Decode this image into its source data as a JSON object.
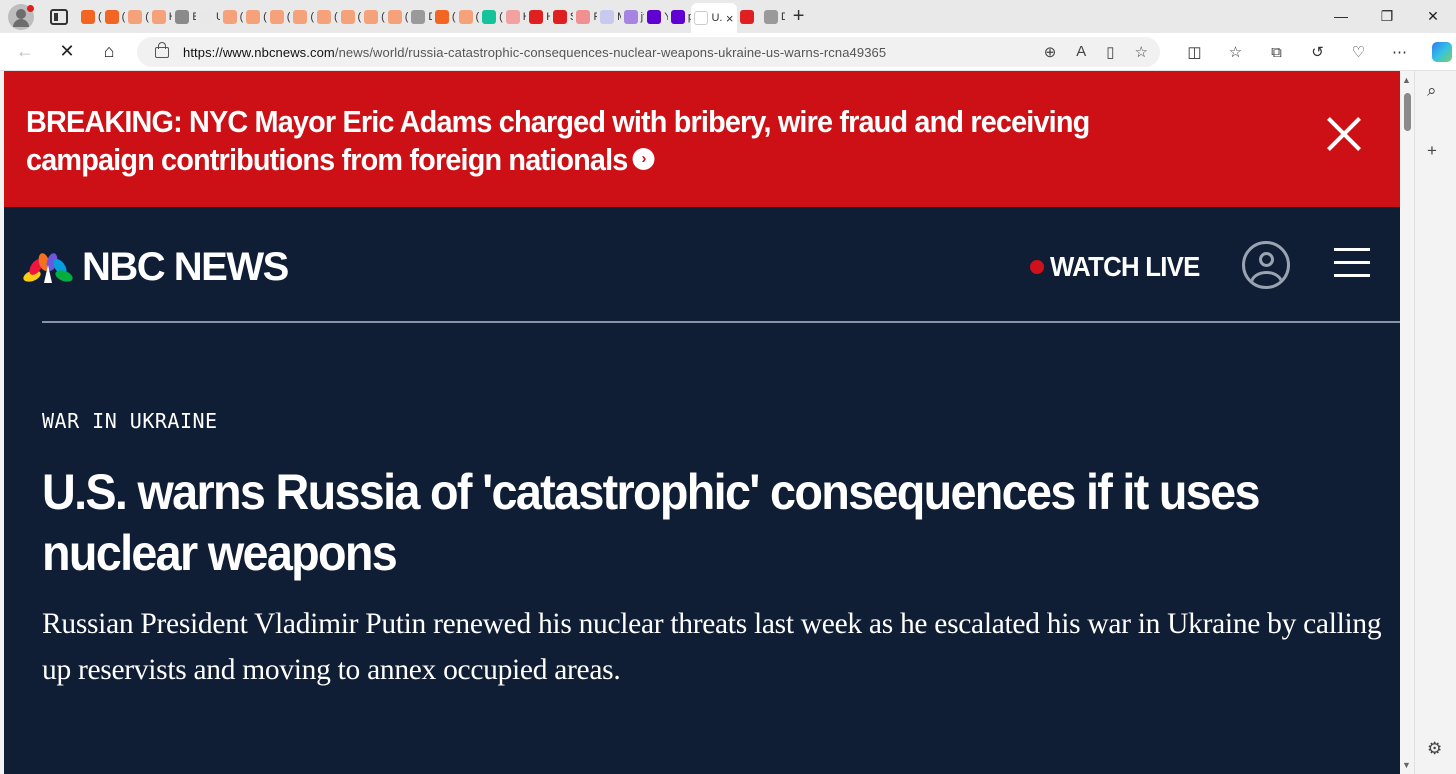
{
  "browser": {
    "tabs": [
      {
        "label": "(1(",
        "color": "#f26522"
      },
      {
        "label": "(1(",
        "color": "#f26522"
      },
      {
        "label": "(1(",
        "color": "#f5a27a"
      },
      {
        "label": "Hc",
        "color": "#f5a27a"
      },
      {
        "label": "En",
        "color": "#8a8a8a"
      },
      {
        "label": "US",
        "color": "#e8e8e8"
      },
      {
        "label": "(1(",
        "color": "#f5a27a"
      },
      {
        "label": "(1(",
        "color": "#f5a27a"
      },
      {
        "label": "(1(",
        "color": "#f5a27a"
      },
      {
        "label": "(1(",
        "color": "#f5a27a"
      },
      {
        "label": "(1(",
        "color": "#f5a27a"
      },
      {
        "label": "(1(",
        "color": "#f5a27a"
      },
      {
        "label": "(1(",
        "color": "#f5a27a"
      },
      {
        "label": "(1(",
        "color": "#f5a27a"
      },
      {
        "label": "De",
        "color": "#9a9a9a"
      },
      {
        "label": "(1(",
        "color": "#f26522"
      },
      {
        "label": "(1(",
        "color": "#f5a27a"
      },
      {
        "label": "(4!",
        "color": "#15c39a"
      },
      {
        "label": "Hc",
        "color": "#f2a0a0"
      },
      {
        "label": "Hc",
        "color": "#e02020"
      },
      {
        "label": "Se",
        "color": "#e02020"
      },
      {
        "label": "Fr(",
        "color": "#f09090"
      },
      {
        "label": "Ma",
        "color": "#c9c9f0"
      },
      {
        "label": "jfk",
        "color": "#a685e2"
      },
      {
        "label": "Ya",
        "color": "#6001d2"
      },
      {
        "label": "pu",
        "color": "#6001d2"
      }
    ],
    "active_tab": {
      "label": "U.",
      "close": "×"
    },
    "after_tabs": [
      {
        "label": "",
        "color": "#e02020"
      },
      {
        "label": "DF",
        "color": "#9a9a9a"
      }
    ],
    "new_tab": "+",
    "window_controls": {
      "minimize": "—",
      "restore": "❐",
      "close": "✕"
    },
    "url_host": "https://www.nbcnews.com",
    "url_path": "/news/world/russia-catastrophic-consequences-nuclear-weapons-ukraine-us-warns-rcna49365"
  },
  "page": {
    "breaking_banner": {
      "text": "BREAKING: NYC Mayor Eric Adams charged with bribery, wire fraud and receiving campaign contributions from foreign nationals",
      "arrow": "›",
      "background": "#cc1016"
    },
    "header": {
      "logo_text": "NBC NEWS",
      "watch_live": "WATCH LIVE",
      "live_dot_color": "#d0101a",
      "background": "#0f1e35"
    },
    "article": {
      "eyebrow": "WAR IN UKRAINE",
      "headline": "U.S. warns Russia of 'catastrophic' consequences if it uses nuclear weapons",
      "dek": "Russian President Vladimir Putin renewed his nuclear threats last week as he escalated his war in Ukraine by calling up reservists and moving to annex occupied areas."
    }
  }
}
